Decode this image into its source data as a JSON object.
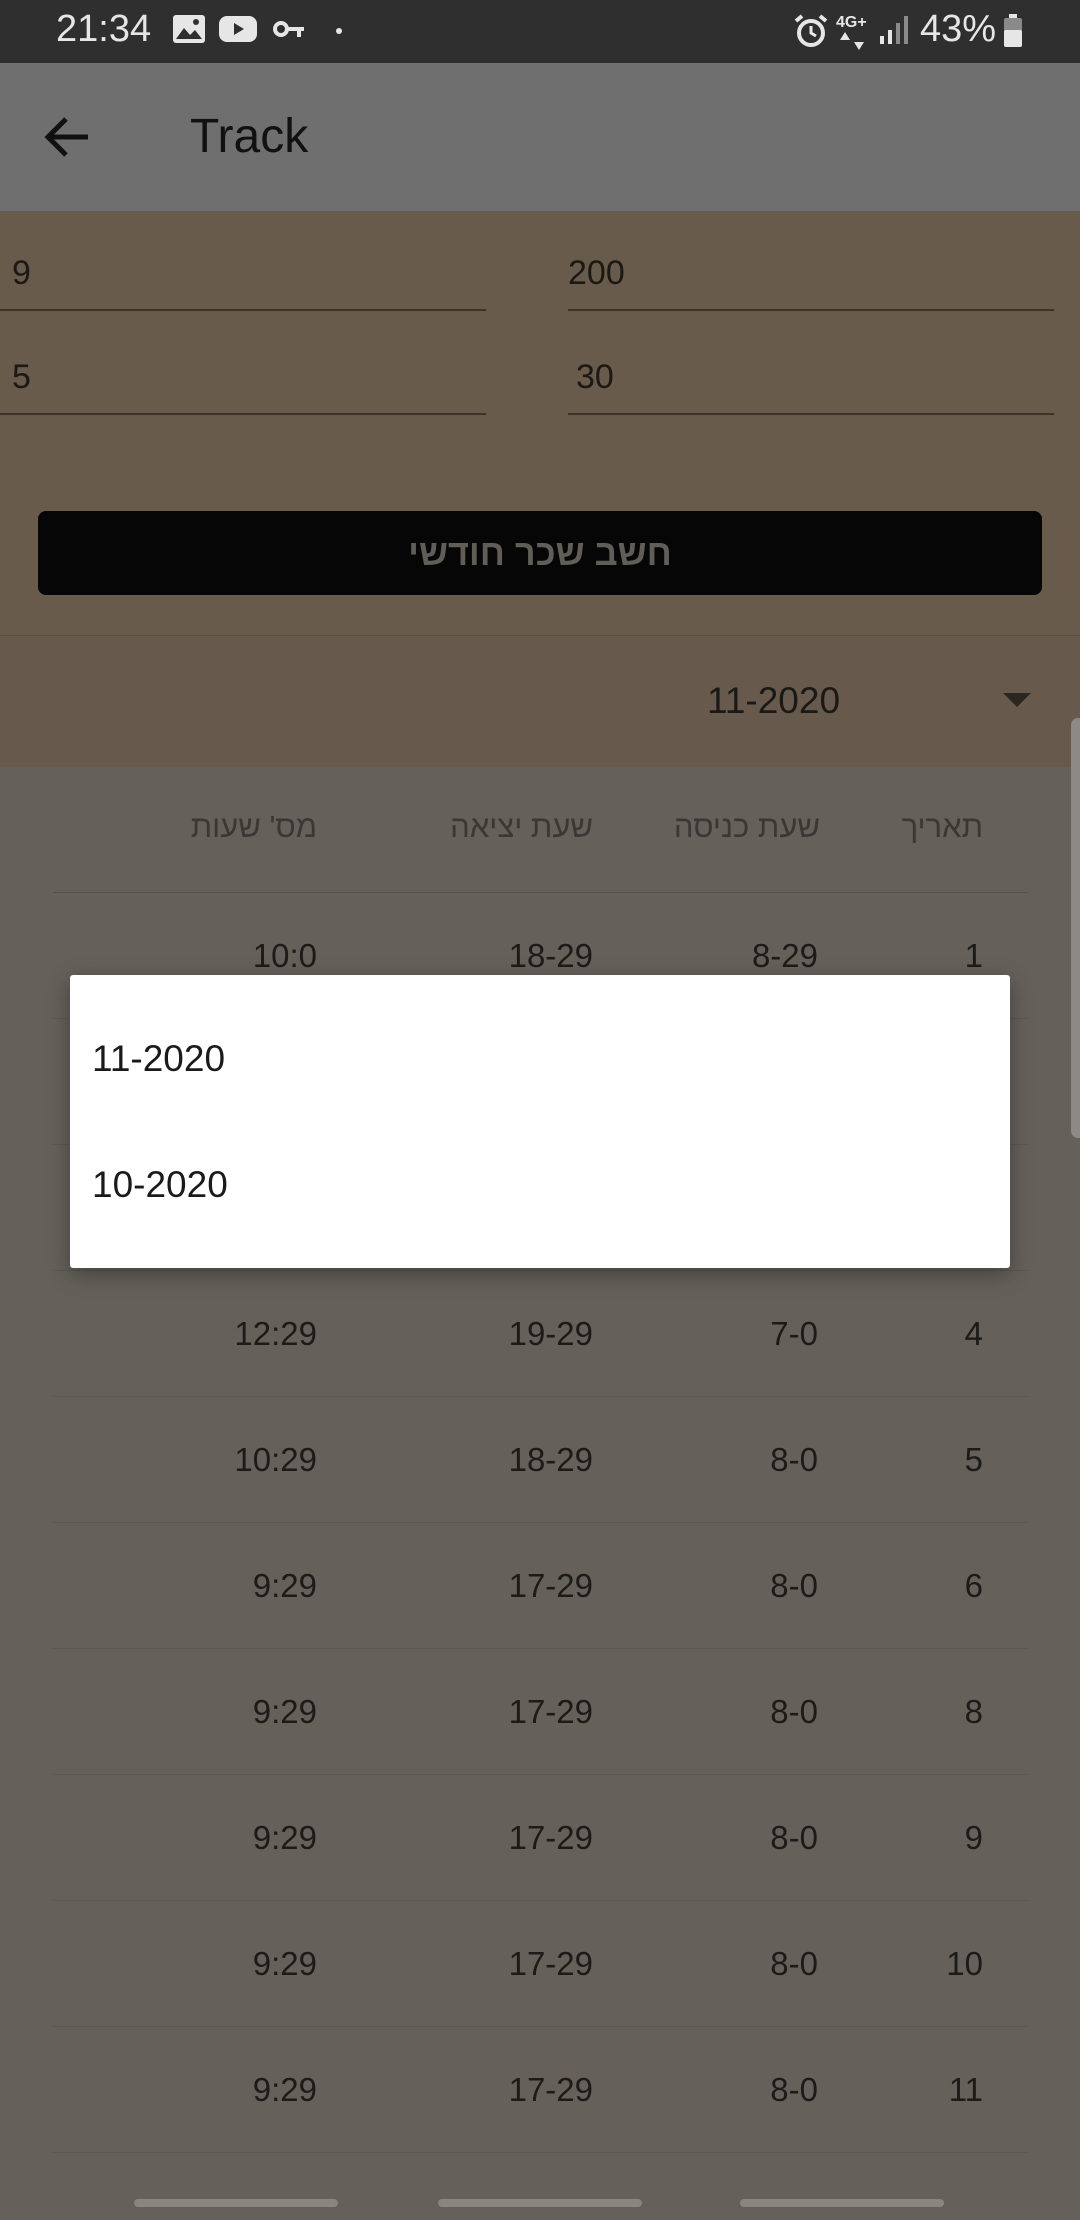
{
  "status_bar": {
    "time": "21:34",
    "network": "4G+",
    "battery": "43%",
    "icons": [
      "image-icon",
      "youtube-icon",
      "key-icon",
      "dot-icon",
      "alarm-icon",
      "signal-icon",
      "battery-icon"
    ]
  },
  "app_bar": {
    "title": "Track",
    "back_icon": "arrow-left-icon"
  },
  "form": {
    "fields": [
      {
        "value": "200"
      },
      {
        "value": "9"
      },
      {
        "value": "30"
      },
      {
        "value": "5"
      }
    ],
    "calc_button": "חשב שכר חודשי"
  },
  "month_selector": {
    "selected": "11-2020",
    "icon": "dropdown-arrow-icon"
  },
  "table": {
    "headers": {
      "date": "תאריך",
      "entry": "שעת כניסה",
      "exit": "שעת יציאה",
      "hours": "מס' שעות"
    },
    "rows": [
      {
        "date": "1",
        "entry": "8-29",
        "exit": "18-29",
        "hours": "10:0"
      },
      {
        "date": "4",
        "entry": "7-0",
        "exit": "19-29",
        "hours": "12:29"
      },
      {
        "date": "5",
        "entry": "8-0",
        "exit": "18-29",
        "hours": "10:29"
      },
      {
        "date": "6",
        "entry": "8-0",
        "exit": "17-29",
        "hours": "9:29"
      },
      {
        "date": "8",
        "entry": "8-0",
        "exit": "17-29",
        "hours": "9:29"
      },
      {
        "date": "9",
        "entry": "8-0",
        "exit": "17-29",
        "hours": "9:29"
      },
      {
        "date": "10",
        "entry": "8-0",
        "exit": "17-29",
        "hours": "9:29"
      },
      {
        "date": "11",
        "entry": "8-0",
        "exit": "17-29",
        "hours": "9:29"
      }
    ]
  },
  "dropdown_popup": {
    "options": [
      "11-2020",
      "10-2020"
    ]
  },
  "colors": {
    "status_bar": "#2f2f2f",
    "app_bar": "#6f6f6f",
    "form_bg": "#685b4c",
    "button_bg": "#060606",
    "list_bg": "#65605a",
    "popup_bg": "#ffffff"
  }
}
